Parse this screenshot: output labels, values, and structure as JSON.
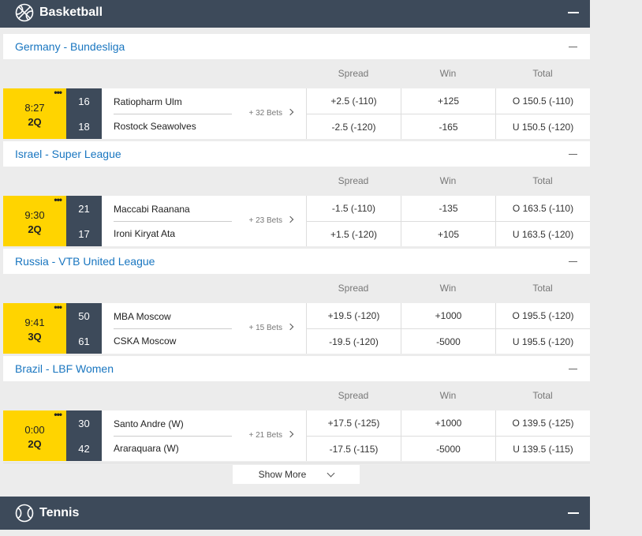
{
  "basketball": {
    "title": "Basketball",
    "icon": "basketball-icon"
  },
  "tennis": {
    "title": "Tennis",
    "icon": "tennis-ball-icon"
  },
  "columns": {
    "spread": "Spread",
    "win": "Win",
    "total": "Total"
  },
  "leagues": [
    {
      "name": "Germany - Bundesliga",
      "event": {
        "time": "8:27",
        "period": "2Q",
        "home": {
          "name": "Ratiopharm Ulm",
          "score": "16",
          "spread": "+2.5 (-110)",
          "win": "+125",
          "total": "O 150.5 (-110)"
        },
        "away": {
          "name": "Rostock Seawolves",
          "score": "18",
          "spread": "-2.5 (-120)",
          "win": "-165",
          "total": "U 150.5 (-120)"
        },
        "bets": "+ 32 Bets"
      }
    },
    {
      "name": "Israel - Super League",
      "event": {
        "time": "9:30",
        "period": "2Q",
        "home": {
          "name": "Maccabi Raanana",
          "score": "21",
          "spread": "-1.5 (-110)",
          "win": "-135",
          "total": "O 163.5 (-110)"
        },
        "away": {
          "name": "Ironi Kiryat Ata",
          "score": "17",
          "spread": "+1.5 (-120)",
          "win": "+105",
          "total": "U 163.5 (-120)"
        },
        "bets": "+ 23 Bets"
      }
    },
    {
      "name": "Russia - VTB United League",
      "event": {
        "time": "9:41",
        "period": "3Q",
        "home": {
          "name": "MBA Moscow",
          "score": "50",
          "spread": "+19.5 (-120)",
          "win": "+1000",
          "total": "O 195.5 (-120)"
        },
        "away": {
          "name": "CSKA Moscow",
          "score": "61",
          "spread": "-19.5 (-120)",
          "win": "-5000",
          "total": "U 195.5 (-120)"
        },
        "bets": "+ 15 Bets"
      }
    },
    {
      "name": "Brazil - LBF Women",
      "event": {
        "time": "0:00",
        "period": "2Q",
        "home": {
          "name": "Santo Andre (W)",
          "score": "30",
          "spread": "+17.5 (-125)",
          "win": "+1000",
          "total": "O 139.5 (-125)"
        },
        "away": {
          "name": "Araraquara (W)",
          "score": "42",
          "spread": "-17.5 (-115)",
          "win": "-5000",
          "total": "U 139.5 (-115)"
        },
        "bets": "+ 21 Bets"
      }
    }
  ],
  "show_more": "Show More",
  "colors": {
    "header_bg": "#3d4a5a",
    "clock_bg": "#ffd400",
    "league_link": "#1976c0"
  }
}
